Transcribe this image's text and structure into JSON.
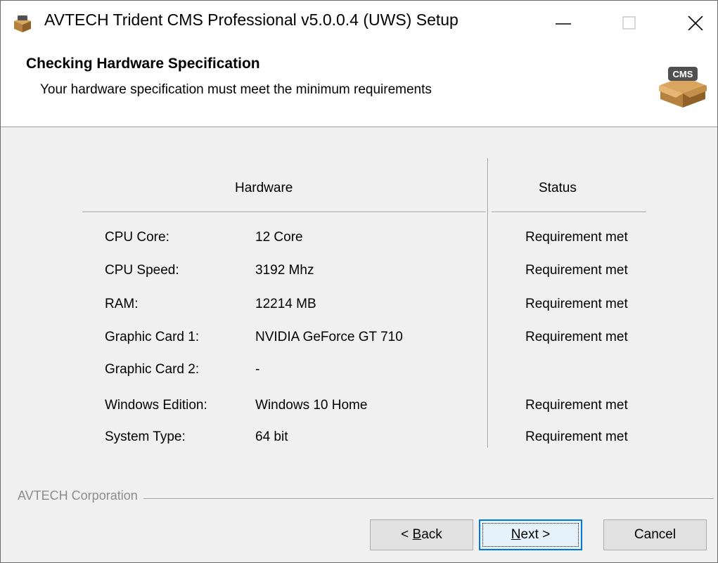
{
  "window": {
    "title": "AVTECH Trident CMS Professional v5.0.0.4 (UWS) Setup"
  },
  "header": {
    "title": "Checking Hardware Specification",
    "subtitle": "Your hardware specification must meet the minimum requirements",
    "icon_badge": "CMS"
  },
  "table": {
    "headers": {
      "hardware": "Hardware",
      "status": "Status"
    },
    "rows": [
      {
        "label": "CPU Core:",
        "value": "12 Core",
        "status": "Requirement met"
      },
      {
        "label": "CPU Speed:",
        "value": "3192 Mhz",
        "status": "Requirement met"
      },
      {
        "label": "RAM:",
        "value": "12214 MB",
        "status": "Requirement met"
      },
      {
        "label": "Graphic Card 1:",
        "value": "NVIDIA GeForce GT 710",
        "status": "Requirement met"
      },
      {
        "label": "Graphic Card 2:",
        "value": "-",
        "status": ""
      },
      {
        "label": "Windows Edition:",
        "value": "Windows 10 Home",
        "status": "Requirement met"
      },
      {
        "label": "System Type:",
        "value": "64 bit",
        "status": "Requirement met"
      }
    ]
  },
  "footer": {
    "brand": "AVTECH Corporation",
    "back": {
      "prefix": "< ",
      "mnemonic": "B",
      "rest": "ack"
    },
    "next": {
      "mnemonic": "N",
      "rest": "ext >"
    },
    "cancel": "Cancel"
  },
  "colors": {
    "focus_border": "#0078d7",
    "box": "#b5813f",
    "badge": "#505050"
  }
}
